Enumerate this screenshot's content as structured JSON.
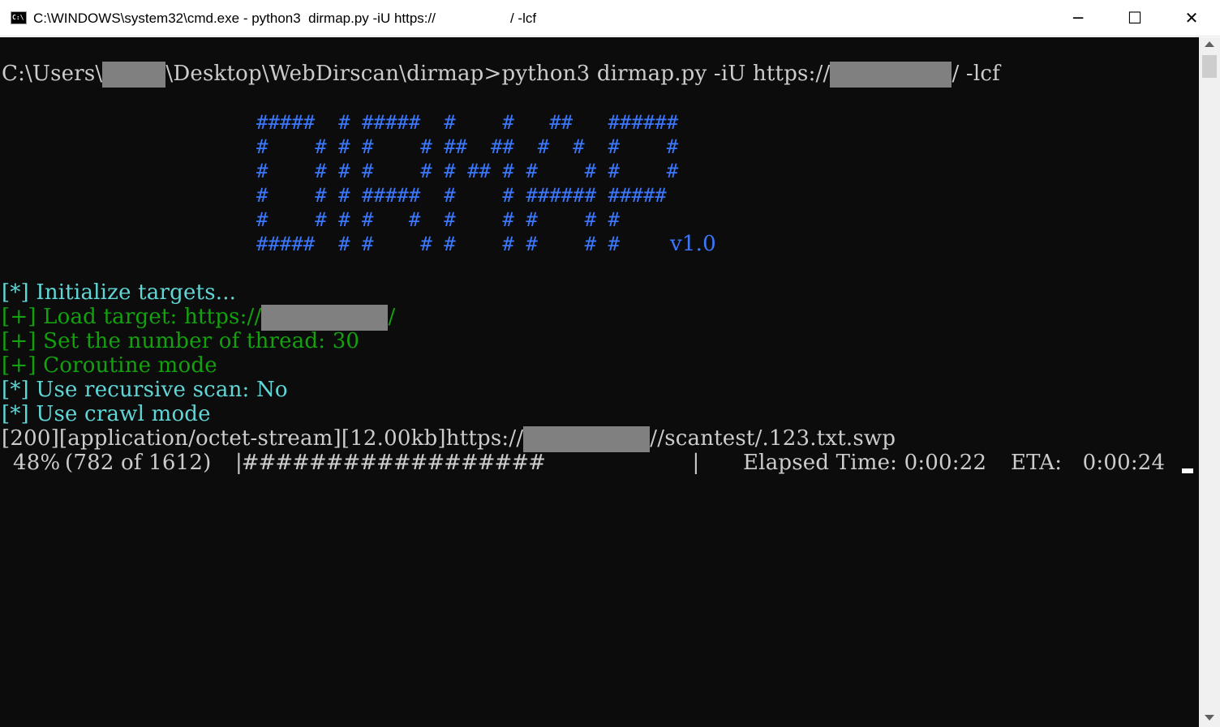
{
  "window": {
    "title_prefix": "C:\\WINDOWS\\system32\\cmd.exe - python3  dirmap.py -iU https://",
    "title_suffix": "/ -lcf",
    "icon_label": "C:\\",
    "minimize_glyph": "─",
    "maximize_glyph": "☐",
    "close_glyph": "✕"
  },
  "prompt": {
    "prefix": "C:\\Users\\",
    "middle": "\\Desktop\\WebDirscan\\dirmap>python3 dirmap.py -iU https://",
    "suffix": "/ -lcf"
  },
  "banner": {
    "lines": [
      "#####  # #####  #    #   ##   ######",
      "#    # # #    # ##  ##  #  #  #    #",
      "#    # # #    # # ## # #    # #    #",
      "#    # # #####  #    # ###### #####",
      "#    # # #   #  #    # #    # #",
      "#####  # #    # #    # #    # #"
    ],
    "version": "v1.0"
  },
  "output": {
    "init": {
      "tag": "[*]",
      "text": " Initialize targets..."
    },
    "load": {
      "tag": "[+]",
      "text": " Load target: https://",
      "suffix": "/"
    },
    "thread": {
      "tag": "[+]",
      "text": " Set the number of thread: 30"
    },
    "coroutine": {
      "tag": "[+]",
      "text": " Coroutine mode"
    },
    "recursive": {
      "tag": "[*]",
      "text": " Use recursive scan: No"
    },
    "crawl": {
      "tag": "[*]",
      "text": " Use crawl mode"
    },
    "result": {
      "prefix": "[200][application/octet-stream][12.00kb]https://",
      "suffix": "//scantest/.123.txt.swp"
    },
    "progress": {
      "percent": "48%",
      "counts": "(782 of 1612)",
      "bar": "|##################                         |",
      "elapsed": "Elapsed Time: 0:00:22",
      "eta": "ETA:   0:00:24"
    }
  },
  "colors": {
    "console_bg": "#0c0c0c",
    "text": "#cccccc",
    "blue": "#3b78ff",
    "cyan": "#61d6d6",
    "green": "#13a10e",
    "redaction": "#808080"
  }
}
